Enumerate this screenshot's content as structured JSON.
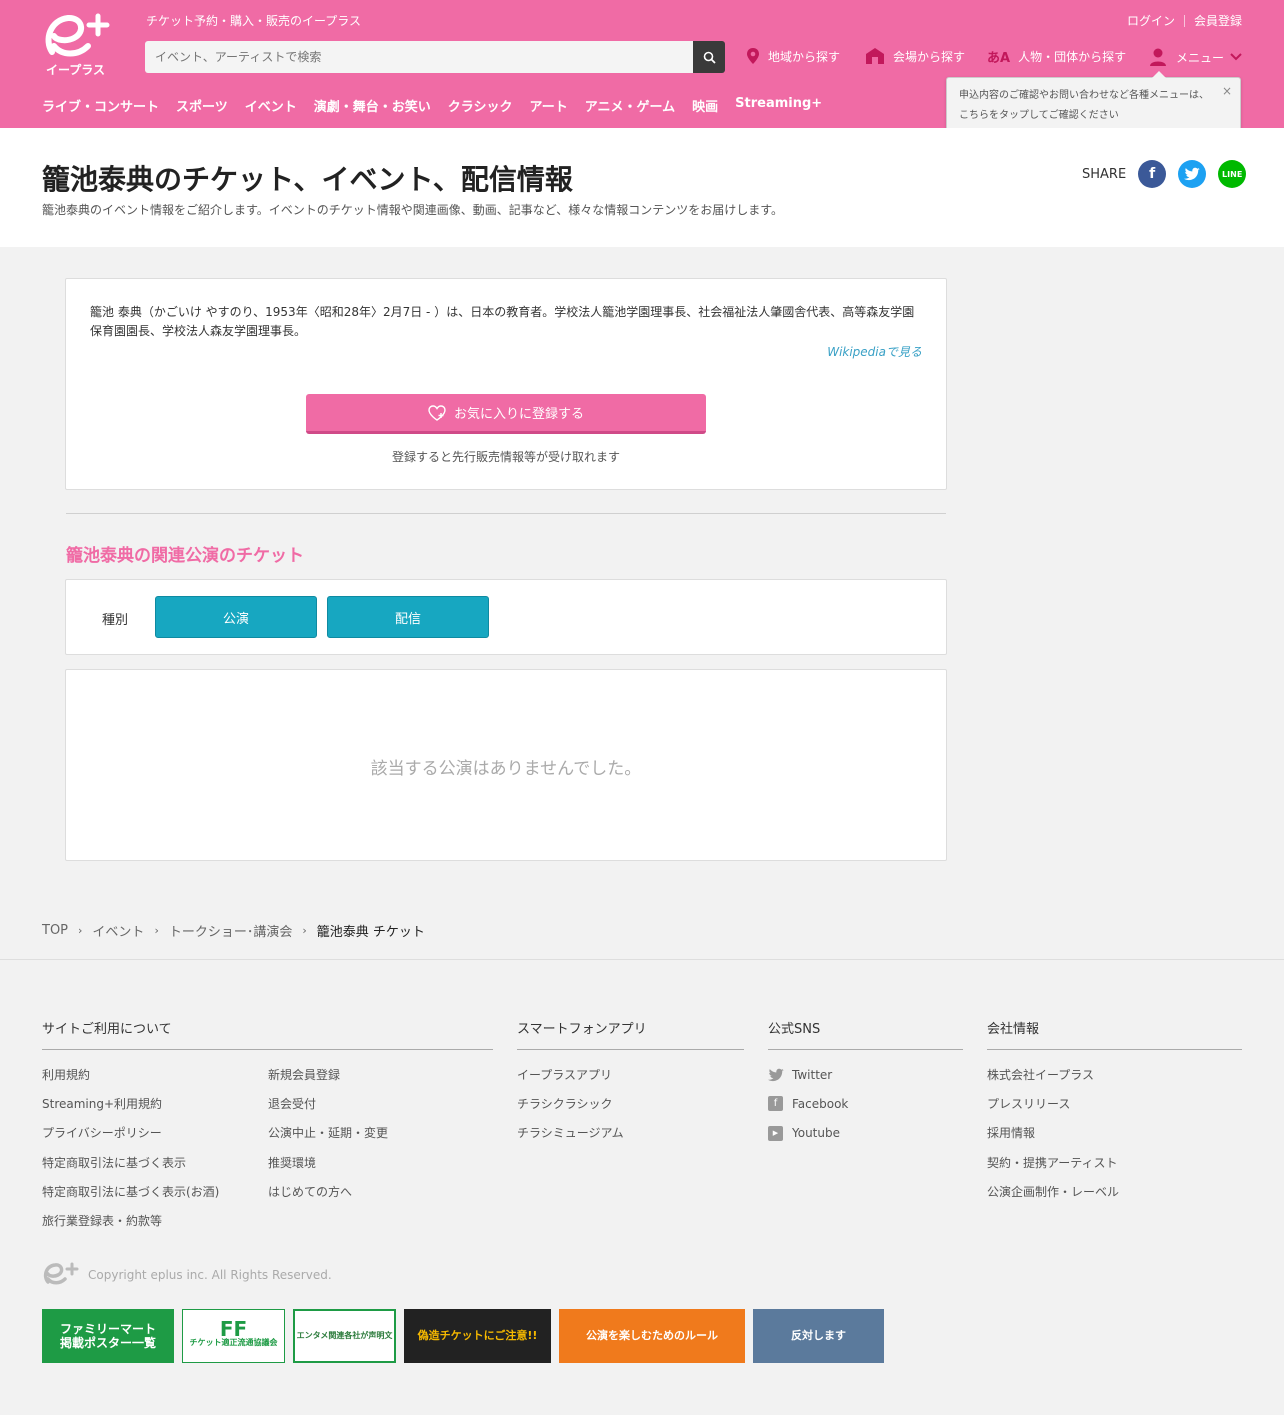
{
  "header": {
    "tagline": "チケット予約・購入・販売のイープラス",
    "search_placeholder": "イベント、アーティストで検索",
    "login": "ログイン",
    "register": "会員登録",
    "nav_area": "地域から探す",
    "nav_venue": "会場から探す",
    "nav_person": "人物・団体から探す",
    "nav_menu": "メニュー",
    "person_icon_text": "あA",
    "categories": [
      "ライブ・コンサート",
      "スポーツ",
      "イベント",
      "演劇・舞台・お笑い",
      "クラシック",
      "アート",
      "アニメ・ゲーム",
      "映画",
      "Streaming+"
    ]
  },
  "tooltip": {
    "line1": "申込内容のご確認やお問い合わせなど各種メニューは、",
    "line2": "こちらをタップしてご確認ください",
    "close": "×"
  },
  "title": {
    "heading": "籠池泰典のチケット、イベント、配信情報",
    "description": "籠池泰典のイベント情報をご紹介します。イベントのチケット情報や関連画像、動画、記事など、様々な情報コンテンツをお届けします。",
    "share_label": "SHARE",
    "fb": "f",
    "line": "LINE"
  },
  "bio": {
    "text": "籠池 泰典（かごいけ やすのり、1953年〈昭和28年〉2月7日 - ）は、日本の教育者。学校法人籠池学園理事長、社会福祉法人肇國舎代表、高等森友学園保育園園長、学校法人森友学園理事長。",
    "wiki_link": "Wikipediaで見る",
    "fav_button": "お気に入りに登録する",
    "fav_note": "登録すると先行販売情報等が受け取れます"
  },
  "related": {
    "section_title": "籠池泰典の関連公演のチケット",
    "filter_label": "種別",
    "filter_performance": "公演",
    "filter_stream": "配信",
    "empty_message": "該当する公演はありませんでした。"
  },
  "breadcrumb": [
    "TOP",
    "イベント",
    "トークショー･講演会",
    "籠池泰典 チケット"
  ],
  "footer": {
    "site_title": "サイトご利用について",
    "site_links_a": [
      "利用規約",
      "Streaming+利用規約",
      "プライバシーポリシー",
      "特定商取引法に基づく表示",
      "特定商取引法に基づく表示(お酒)",
      "旅行業登録表・約款等"
    ],
    "site_links_b": [
      "新規会員登録",
      "退会受付",
      "公演中止・延期・変更",
      "推奨環境",
      "はじめての方へ"
    ],
    "app_title": "スマートフォンアプリ",
    "app_links": [
      "イープラスアプリ",
      "チラシクラシック",
      "チラシミュージアム"
    ],
    "sns_title": "公式SNS",
    "sns_links": [
      "Twitter",
      "Facebook",
      "Youtube"
    ],
    "company_title": "会社情報",
    "company_links": [
      "株式会社イープラス",
      "プレスリリース",
      "採用情報",
      "契約・提携アーティスト",
      "公演企画制作・レーベル"
    ],
    "copyright": "Copyright eplus inc. All Rights Reserved."
  },
  "banners": {
    "b1": "ファミリーマート\n掲載ポスター一覧",
    "b2": "チケット適正流通協議会",
    "b3": "エンタメ関連各社が声明文",
    "b4": "偽造チケットにご注意!!",
    "b5": "公演を楽しむためのルール",
    "b6": "反対します"
  },
  "colors": {
    "brand_pink": "#f06ba5",
    "filter_teal": "#17a7c1",
    "link_blue": "#3aa1c6"
  }
}
